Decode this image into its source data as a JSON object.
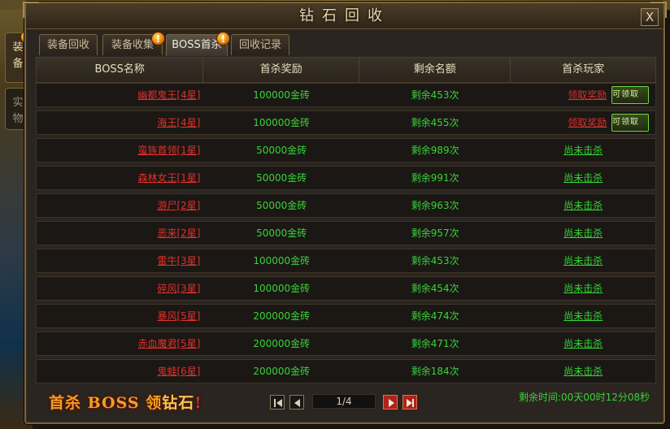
{
  "window": {
    "title": "钻石回收",
    "close_label": "X"
  },
  "side_tabs": [
    {
      "chars": [
        "装",
        "备"
      ],
      "badge": "!"
    },
    {
      "chars": [
        "实",
        "物"
      ]
    }
  ],
  "tabs": [
    {
      "label": "装备回收",
      "badge": ""
    },
    {
      "label": "装备收集",
      "badge": "!"
    },
    {
      "label": "BOSS首杀",
      "badge": "!"
    },
    {
      "label": "回收记录",
      "badge": ""
    }
  ],
  "table": {
    "headers": [
      "BOSS名称",
      "首杀奖励",
      "剩余名额",
      "首杀玩家"
    ],
    "rows": [
      {
        "boss": "幽都鬼王[4星]",
        "reward": "100000金砖",
        "remaining": "剩余453次",
        "player": "领取奖励",
        "claim_button": "可领取"
      },
      {
        "boss": "海王[4星]",
        "reward": "100000金砖",
        "remaining": "剩余455次",
        "player": "领取奖励",
        "claim_button": "可领取"
      },
      {
        "boss": "蛮族首领[1星]",
        "reward": "50000金砖",
        "remaining": "剩余989次",
        "player": "尚未击杀"
      },
      {
        "boss": "森林女王[1星]",
        "reward": "50000金砖",
        "remaining": "剩余991次",
        "player": "尚未击杀"
      },
      {
        "boss": "游尸[2星]",
        "reward": "50000金砖",
        "remaining": "剩余963次",
        "player": "尚未击杀"
      },
      {
        "boss": "恶来[2星]",
        "reward": "50000金砖",
        "remaining": "剩余957次",
        "player": "尚未击杀"
      },
      {
        "boss": "雷牛[3星]",
        "reward": "100000金砖",
        "remaining": "剩余453次",
        "player": "尚未击杀"
      },
      {
        "boss": "碎风[3星]",
        "reward": "100000金砖",
        "remaining": "剩余454次",
        "player": "尚未击杀"
      },
      {
        "boss": "暴风[5星]",
        "reward": "200000金砖",
        "remaining": "剩余474次",
        "player": "尚未击杀"
      },
      {
        "boss": "赤血魔君[5星]",
        "reward": "200000金砖",
        "remaining": "剩余471次",
        "player": "尚未击杀"
      },
      {
        "boss": "鬼蛙[6星]",
        "reward": "200000金砖",
        "remaining": "剩余184次",
        "player": "尚未击杀"
      }
    ]
  },
  "footer": {
    "banner_part1": "首杀 BOSS 领",
    "banner_part2": "钻石",
    "banner_part3": "!",
    "page_indicator": "1/4",
    "countdown": "剩余时间:00天00时12分08秒"
  },
  "colors": {
    "boss_name": "#e0302a",
    "positive": "#3ad23a",
    "frame": "#7a6438"
  }
}
